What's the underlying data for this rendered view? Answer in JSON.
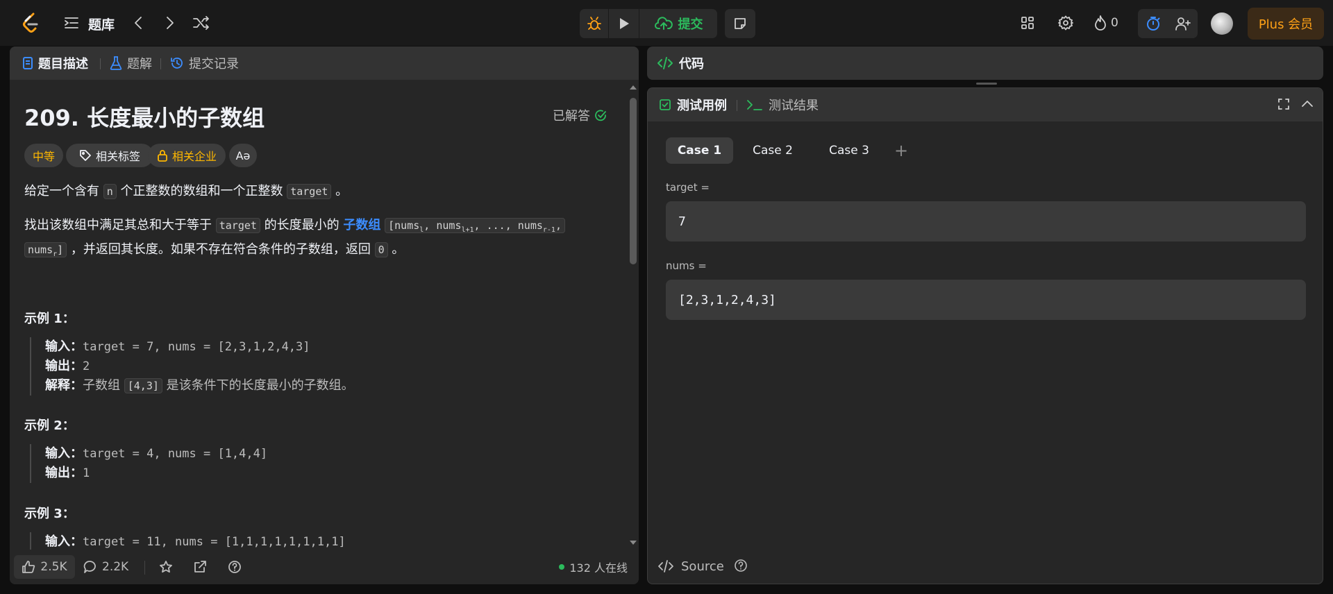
{
  "nav": {
    "bank_label": "题库",
    "submit_label": "提交",
    "streak_count": "0",
    "plus_label": "Plus 会员"
  },
  "left_tabs": {
    "description": "题目描述",
    "solutions": "题解",
    "submissions": "提交记录"
  },
  "problem": {
    "title": "209. 长度最小的子数组",
    "status": "已解答",
    "difficulty": "中等",
    "tags_label": "相关标签",
    "companies_label": "相关企业",
    "lang_label": "Aǝ",
    "p1_a": "给定一个含有 ",
    "p1_code1": "n",
    "p1_b": " 个正整数的数组和一个正整数 ",
    "p1_code2": "target",
    "p1_c": " 。",
    "p2_a": "找出该数组中满足其总和大于等于 ",
    "p2_code1": "target",
    "p2_b": " 的长度最小的 ",
    "p2_link": "子数组",
    "p2_code2": "[nums",
    "p2_code2_sub1": "l",
    "p2_code2_mid": ", nums",
    "p2_code2_sub2": "l+1",
    "p2_code2_end": ", ..., nums",
    "p2_code2_sub3": "r-1",
    "p2_code2_tail": ",",
    "p2_code3": "nums",
    "p2_code3_sub": "r",
    "p2_code3_end": "]",
    "p2_c": " ，并返回其长度。如果不存在符合条件的子数组，返回 ",
    "p2_code4": "0",
    "p2_d": " 。"
  },
  "examples": [
    {
      "heading": "示例 1：",
      "input_label": "输入：",
      "input": "target = 7, nums = [2,3,1,2,4,3]",
      "output_label": "输出：",
      "output": "2",
      "explain_label": "解释：",
      "explain_a": "子数组 ",
      "explain_code": "[4,3]",
      "explain_b": " 是该条件下的长度最小的子数组。"
    },
    {
      "heading": "示例 2：",
      "input_label": "输入：",
      "input": "target = 4, nums = [1,4,4]",
      "output_label": "输出：",
      "output": "1"
    },
    {
      "heading": "示例 3：",
      "input_label": "输入：",
      "input": "target = 11, nums = [1,1,1,1,1,1,1,1]"
    }
  ],
  "footer": {
    "likes": "2.5K",
    "comments": "2.2K",
    "online": "132 人在线"
  },
  "code_panel": {
    "tab_label": "代码"
  },
  "test_panel": {
    "cases_tab": "测试用例",
    "results_tab": "测试结果",
    "cases": [
      "Case 1",
      "Case 2",
      "Case 3"
    ],
    "add_case": "+",
    "target_label": "target =",
    "target_value": "7",
    "nums_label": "nums =",
    "nums_value": "[2,3,1,2,4,3]",
    "source_label": "Source"
  },
  "colors": {
    "accent_green": "#2cbb5d",
    "medium_orange": "#ffb800",
    "link_blue": "#3c8dff",
    "plus_orange": "#ffa116",
    "tab_blue": "#3c8dff"
  },
  "icons": [
    "logo-icon",
    "list-icon",
    "chevron-left-icon",
    "chevron-right-icon",
    "shuffle-icon",
    "debug-icon",
    "play-icon",
    "cloud-upload-icon",
    "note-icon",
    "layout-icon",
    "gear-icon",
    "flame-icon",
    "timer-icon",
    "add-user-icon",
    "doc-icon",
    "flask-icon",
    "history-icon",
    "check-circle-icon",
    "tag-icon",
    "lock-icon",
    "thumbs-up-icon",
    "comment-icon",
    "star-icon",
    "share-icon",
    "help-icon",
    "code-icon",
    "checkbox-icon",
    "terminal-icon",
    "expand-icon",
    "chevron-up-icon"
  ]
}
